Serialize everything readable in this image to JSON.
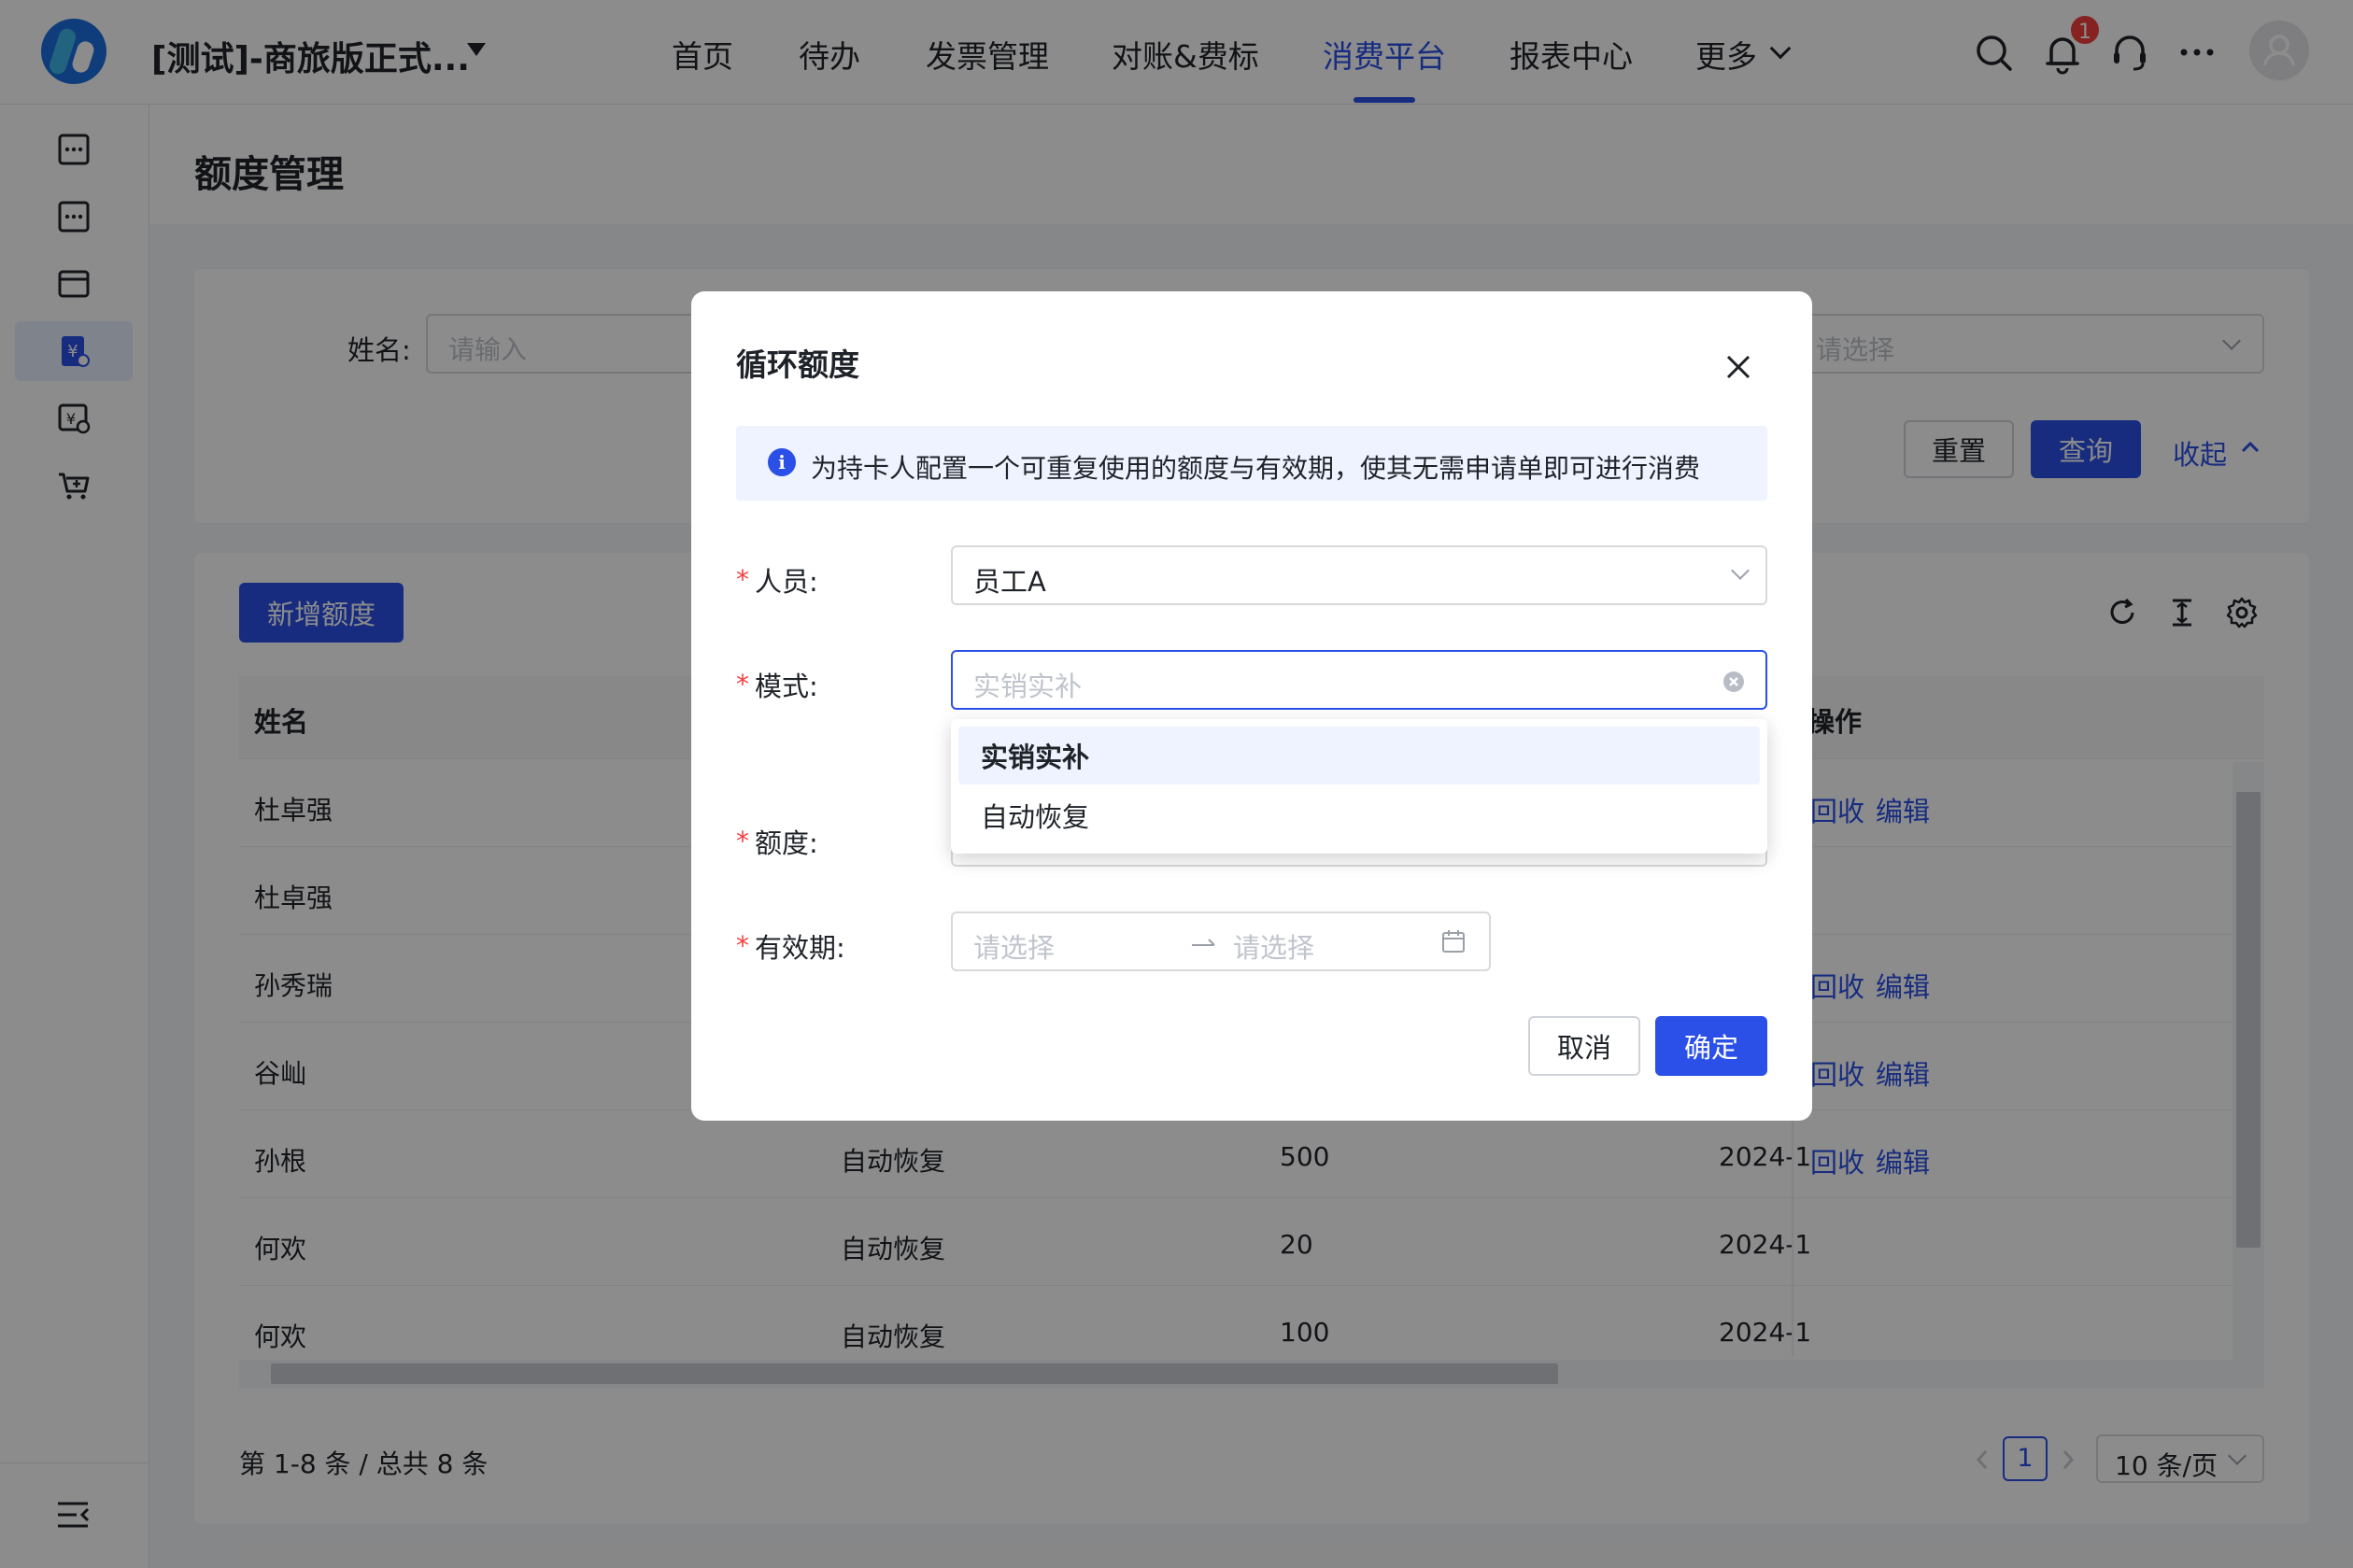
{
  "header": {
    "company": "[测试]-商旅版正式...",
    "nav": [
      "首页",
      "待办",
      "发票管理",
      "对账&费标",
      "消费平台",
      "报表中心",
      "更多"
    ],
    "active_nav": "消费平台",
    "notification_count": "1",
    "accent_color": "#2b50e8"
  },
  "sidebar": {
    "icons": [
      "more-box-icon",
      "more-box-icon",
      "card-icon",
      "yuan-add-icon",
      "yuan-clock-icon",
      "cart-icon"
    ],
    "active_index": 3,
    "collapse_icon": "menu-collapse-icon"
  },
  "page": {
    "title": "额度管理"
  },
  "filter": {
    "name_label": "姓名:",
    "name_placeholder": "请输入",
    "select_placeholder": "请选择",
    "reset_label": "重置",
    "query_label": "查询",
    "collapse_label": "收起"
  },
  "table": {
    "add_label": "新增额度",
    "columns": [
      "姓名",
      "操作"
    ],
    "rows": [
      {
        "name": "杜卓强",
        "mode": "",
        "amount": "",
        "date": "",
        "actions": [
          "回收",
          "编辑"
        ]
      },
      {
        "name": "杜卓强",
        "mode": "",
        "amount": "",
        "date": "",
        "actions": []
      },
      {
        "name": "孙秀瑞",
        "mode": "",
        "amount": "",
        "date": "",
        "actions": [
          "回收",
          "编辑"
        ]
      },
      {
        "name": "谷屾",
        "mode": "",
        "amount": "",
        "date": "",
        "actions": [
          "回收",
          "编辑"
        ]
      },
      {
        "name": "孙根",
        "mode": "自动恢复",
        "amount": "500",
        "date": "2024-1",
        "actions": [
          "回收",
          "编辑"
        ]
      },
      {
        "name": "何欢",
        "mode": "自动恢复",
        "amount": "20",
        "date": "2024-1",
        "actions": []
      },
      {
        "name": "何欢",
        "mode": "自动恢复",
        "amount": "100",
        "date": "2024-1",
        "actions": []
      }
    ],
    "total_text": "第 1-8 条 / 总共 8 条",
    "current_page": "1",
    "page_size": "10 条/页"
  },
  "modal": {
    "title": "循环额度",
    "info": "为持卡人配置一个可重复使用的额度与有效期，使其无需申请单即可进行消费",
    "person_label": "人员:",
    "person_value": "员工A",
    "mode_label": "模式:",
    "mode_placeholder": "实销实补",
    "amount_label": "额度:",
    "validity_label": "有效期:",
    "date_start_placeholder": "请选择",
    "date_end_placeholder": "请选择",
    "mode_options": [
      "实销实补",
      "自动恢复"
    ],
    "cancel_label": "取消",
    "confirm_label": "确定"
  }
}
